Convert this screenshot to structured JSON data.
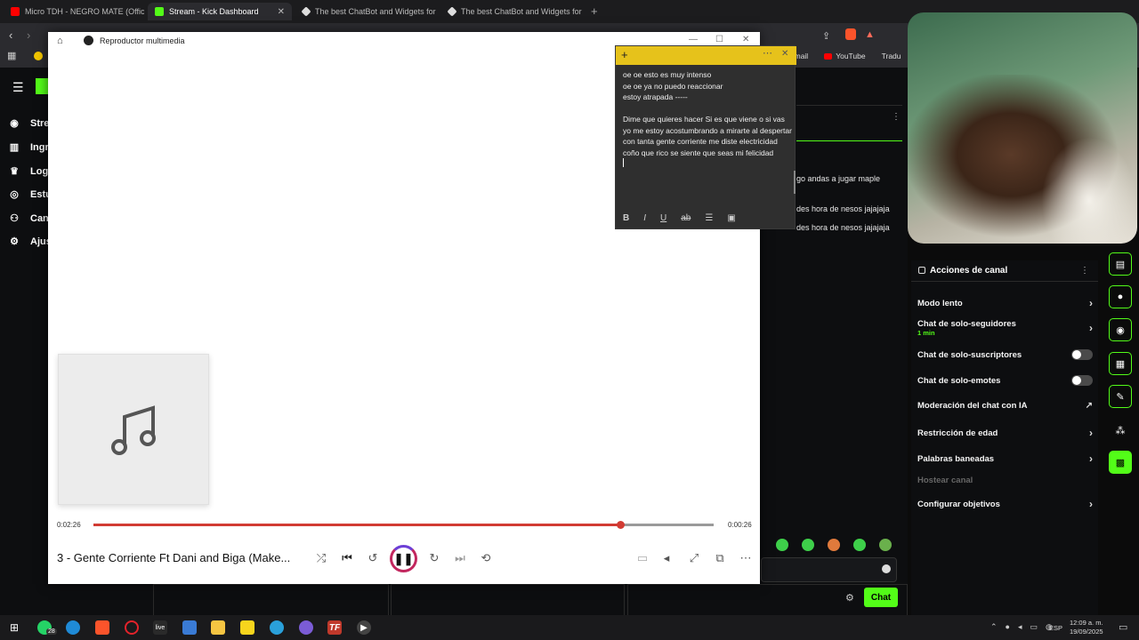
{
  "browser": {
    "tabs": [
      {
        "label": "Micro TDH - NEGRO MATE (Official V",
        "color": "#ff0000"
      },
      {
        "label": "Stream - Kick Dashboard",
        "color": "#53fc18"
      },
      {
        "label": "The best ChatBot and Widgets for Ki",
        "color": "#ffffff"
      },
      {
        "label": "The best ChatBot and Widgets for Ki",
        "color": "#ffffff"
      }
    ],
    "new_tab": "+",
    "bookmarks": [
      "Gmail",
      "YouTube",
      "Tradu"
    ]
  },
  "kick": {
    "sidebar": [
      "Stre",
      "Ingr",
      "Log",
      "Estu",
      "Can",
      "Ajus"
    ],
    "chat_messages": [
      "go andas a jugar maple",
      "des hora de nesos jajajaja",
      "des hora de nesos jajajaja"
    ],
    "chat_button": "Chat",
    "accent": "#53fc18"
  },
  "player": {
    "title": "Reproductor multimedia",
    "elapsed": "0:02:26",
    "remaining": "0:00:26",
    "progress": 0.85,
    "track": "3 - Gente Corriente Ft Dani and Biga (Make..."
  },
  "sticky": {
    "lines": [
      "oe oe esto es muy intenso",
      "oe oe ya no puedo reaccionar",
      "estoy atrapada -----",
      "",
      "Dime que quieres hacer Si es que viene o si vas",
      "yo me estoy acostumbrando a mirarte al despertar",
      "con tanta gente corriente me diste electricidad",
      "coño que rico se siente que seas mi felicidad"
    ],
    "color": "#e6c21b"
  },
  "actions": {
    "header": "Acciones de canal",
    "rows": [
      {
        "label": "Modo lento",
        "control": "chevron"
      },
      {
        "label": "Chat de solo-seguidores",
        "sub": "1 min",
        "control": "chevron"
      },
      {
        "label": "Chat de solo-suscriptores",
        "control": "toggle"
      },
      {
        "label": "Chat de solo-emotes",
        "control": "toggle"
      },
      {
        "label": "Moderación del chat con IA",
        "control": "external"
      },
      {
        "label": "Restricción de edad",
        "control": "chevron"
      },
      {
        "label": "Palabras baneadas",
        "control": "chevron"
      },
      {
        "label": "Hostear canal",
        "control": "none",
        "disabled": true
      },
      {
        "label": "Configurar objetivos",
        "control": "chevron"
      }
    ]
  },
  "taskbar": {
    "lang": "ESP",
    "time": "12:09 a. m.",
    "date": "19/09/2025",
    "whatsapp_badge": "28"
  }
}
